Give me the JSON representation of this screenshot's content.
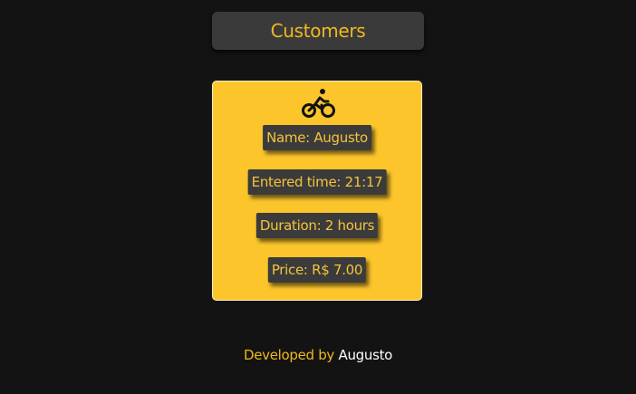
{
  "header": {
    "title": "Customers"
  },
  "card": {
    "icon": "bicycle-rider-icon",
    "name": "Name: Augusto",
    "entered_time": "Entered time: 21:17",
    "duration": "Duration: 2 hours",
    "price": "Price: R$ 7.00"
  },
  "footer": {
    "prefix": "Developed by",
    "author": "Augusto"
  },
  "colors": {
    "background": "#131313",
    "accent": "#f2b81d",
    "card": "#fcc52b",
    "label_bg": "#3b3b3b"
  }
}
